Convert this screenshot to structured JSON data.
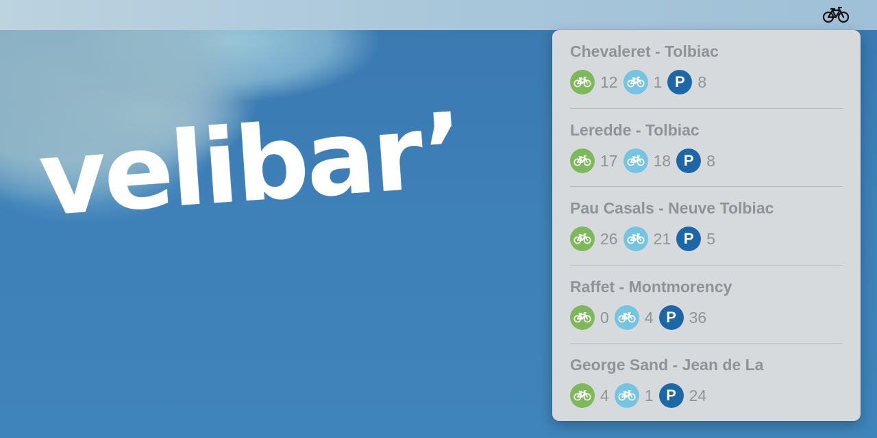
{
  "menubar": {
    "icon": "bicycle-icon"
  },
  "logo": {
    "text": "velibar’"
  },
  "colors": {
    "mechanical": "#7db85a",
    "electric": "#74c4e2",
    "parking": "#1e67a6"
  },
  "stations": [
    {
      "name": "Chevaleret - Tolbiac",
      "mechanical": "12",
      "electric": "1",
      "parking_label": "P",
      "parking": "8"
    },
    {
      "name": "Leredde - Tolbiac",
      "mechanical": "17",
      "electric": "18",
      "parking_label": "P",
      "parking": "8"
    },
    {
      "name": "Pau Casals - Neuve Tolbiac",
      "mechanical": "26",
      "electric": "21",
      "parking_label": "P",
      "parking": "5"
    },
    {
      "name": "Raffet - Montmorency",
      "mechanical": "0",
      "electric": "4",
      "parking_label": "P",
      "parking": "36"
    },
    {
      "name": "George Sand - Jean de La",
      "mechanical": "4",
      "electric": "1",
      "parking_label": "P",
      "parking": "24"
    }
  ]
}
